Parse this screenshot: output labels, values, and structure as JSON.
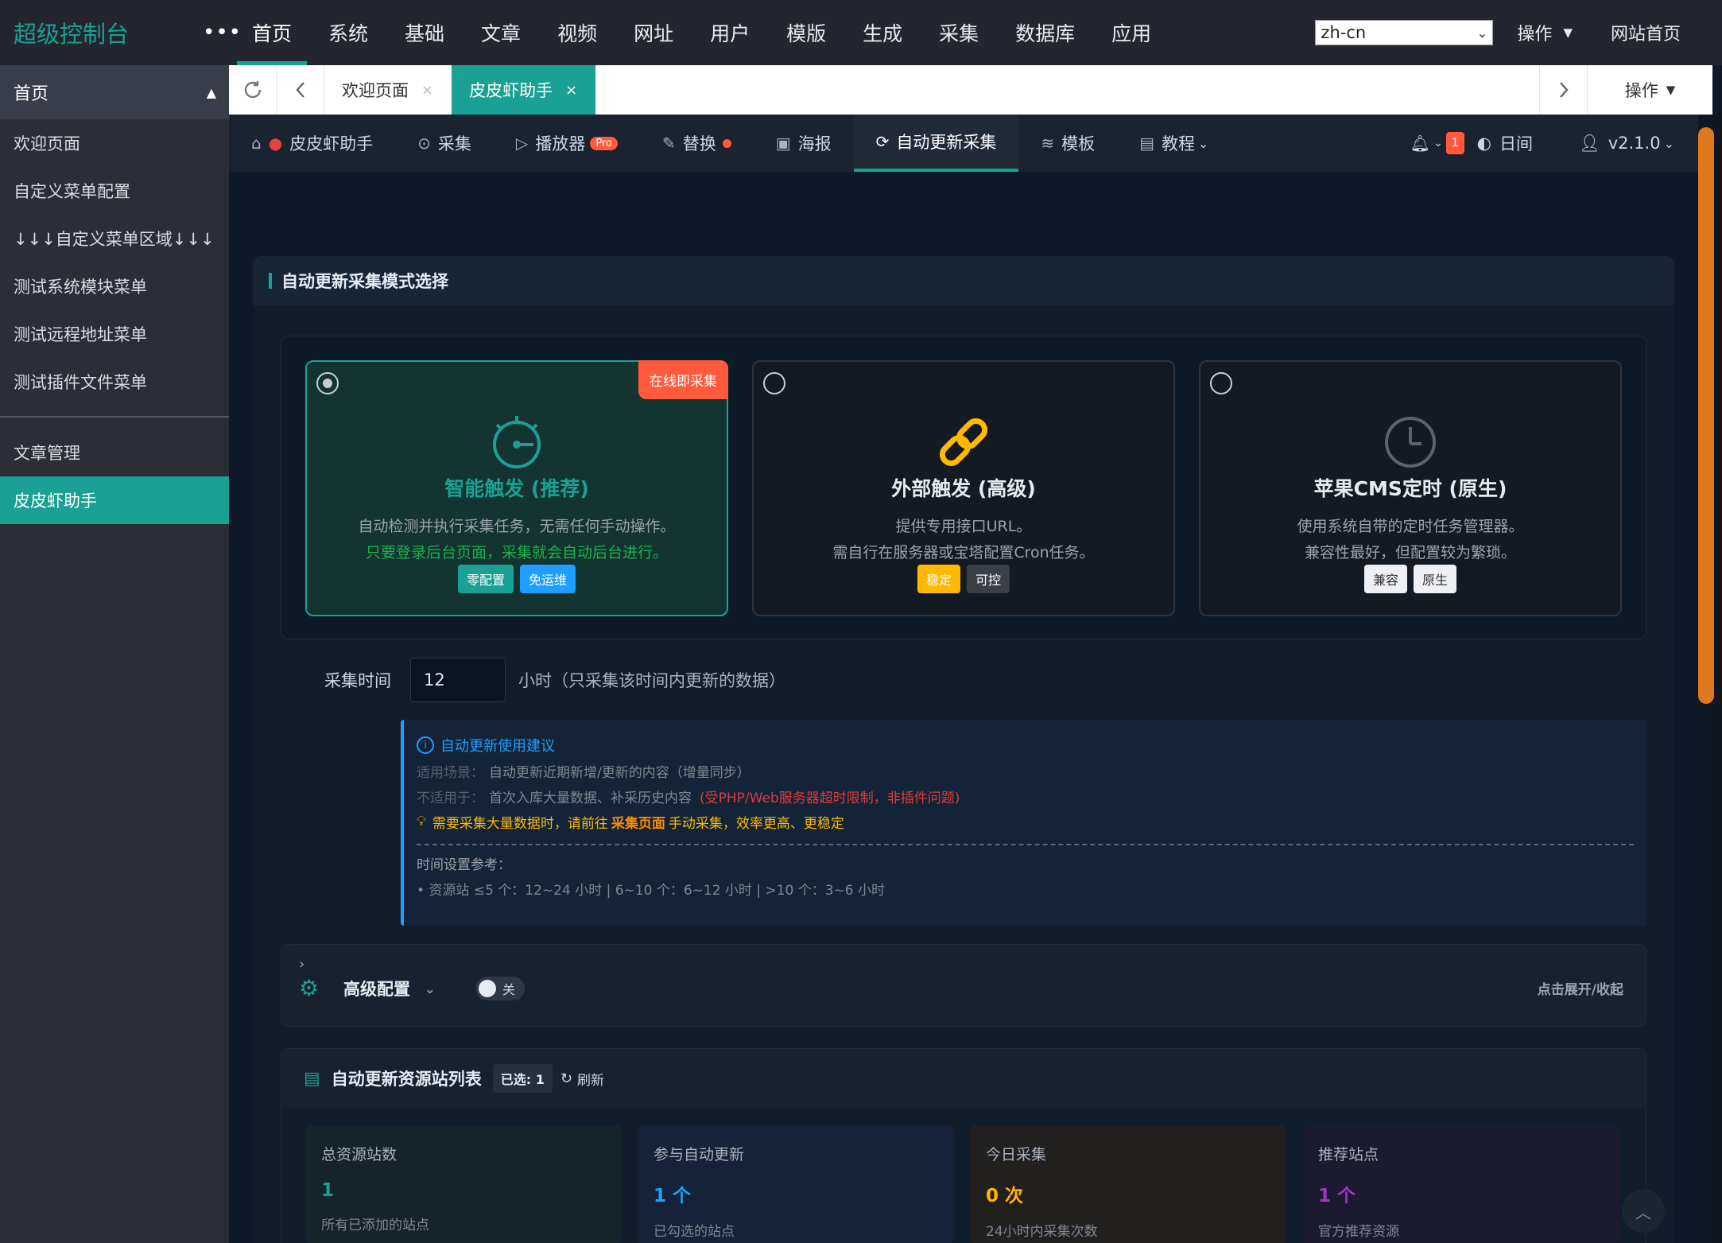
{
  "topbar": {
    "brand": "超级控制台",
    "more": "•••",
    "nav": [
      "首页",
      "系统",
      "基础",
      "文章",
      "视频",
      "网址",
      "用户",
      "模版",
      "生成",
      "采集",
      "数据库",
      "应用"
    ],
    "lang_value": "zh-cn",
    "ops_label": "操作",
    "home_link": "网站首页"
  },
  "sidebar": {
    "header": "首页",
    "items": [
      "欢迎页面",
      "自定义菜单配置",
      "↓↓↓自定义菜单区域↓↓↓",
      "测试系统模块菜单",
      "测试远程地址菜单",
      "测试插件文件菜单"
    ],
    "section_items": [
      "文章管理",
      "皮皮虾助手"
    ]
  },
  "tabbar": {
    "tabs": [
      {
        "label": "欢迎页面",
        "close": "×"
      },
      {
        "label": "皮皮虾助手",
        "close": "×"
      }
    ],
    "ops_label": "操作"
  },
  "subnav": {
    "items": [
      "皮皮虾助手",
      "采集",
      "播放器",
      "替换",
      "海报",
      "自动更新采集",
      "模板",
      "教程"
    ],
    "pro_badge": "Pro",
    "notify_count": "1",
    "day_night": "日间",
    "version": "v2.1.0"
  },
  "panel": {
    "title": "自动更新采集模式选择",
    "modes": [
      {
        "title": "智能触发 (推荐)",
        "corner_tag": "在线即采集",
        "desc1": "自动检测并执行采集任务，无需任何手动操作。",
        "desc2": "只要登录后台页面，采集就会自动后台进行。",
        "tags": [
          "零配置",
          "免运维"
        ],
        "selected": true
      },
      {
        "title": "外部触发 (高级)",
        "desc1": "提供专用接口URL。",
        "desc2": "需自行在服务器或宝塔配置Cron任务。",
        "tags": [
          "稳定",
          "可控"
        ],
        "selected": false
      },
      {
        "title": "苹果CMS定时 (原生)",
        "desc1": "使用系统自带的定时任务管理器。",
        "desc2": "兼容性最好，但配置较为繁琐。",
        "tags": [
          "兼容",
          "原生"
        ],
        "selected": false
      }
    ],
    "time": {
      "label": "采集时间",
      "value": "12",
      "hint": "小时（只采集该时间内更新的数据）"
    },
    "tips": {
      "title": "自动更新使用建议",
      "scene_label": "适用场景：",
      "scene_text": "自动更新近期新增/更新的内容（增量同步）",
      "not_label": "不适用于：",
      "not_text": "首次入库大量数据、补采历史内容",
      "not_red": "(受PHP/Web服务器超时限制，非插件问题)",
      "warn_pre": "需要采集大量数据时，请前往",
      "warn_bold": "采集页面",
      "warn_post": "手动采集，效率更高、更稳定",
      "ref_title": "时间设置参考：",
      "ref_text": "• 资源站 ≤5 个：12~24 小时 | 6~10 个：6~12 小时 | >10 个：3~6 小时"
    },
    "advanced": {
      "label": "高级配置",
      "switch_state": "关",
      "hint": "点击展开/收起"
    },
    "sites": {
      "title": "自动更新资源站列表",
      "selected_badge": "已选: 1",
      "refresh": "刷新",
      "stats": [
        {
          "label": "总资源站数",
          "value": "1",
          "sub": "所有已添加的站点",
          "color": "#1aa094"
        },
        {
          "label": "参与自动更新",
          "value": "1 个",
          "sub": "已勾选的站点",
          "color": "#1e9fff"
        },
        {
          "label": "今日采集",
          "value": "0 次",
          "sub": "24小时内采集次数",
          "color": "#ffb800"
        },
        {
          "label": "推荐站点",
          "value": "1 个",
          "sub": "官方推荐资源",
          "color": "#a233c6"
        }
      ]
    }
  },
  "colors": {
    "accent": "#1aa094",
    "danger": "#ff5a3c",
    "info": "#1e9fff",
    "warning": "#ffb800",
    "scroll_thumb": "#e0781d"
  }
}
